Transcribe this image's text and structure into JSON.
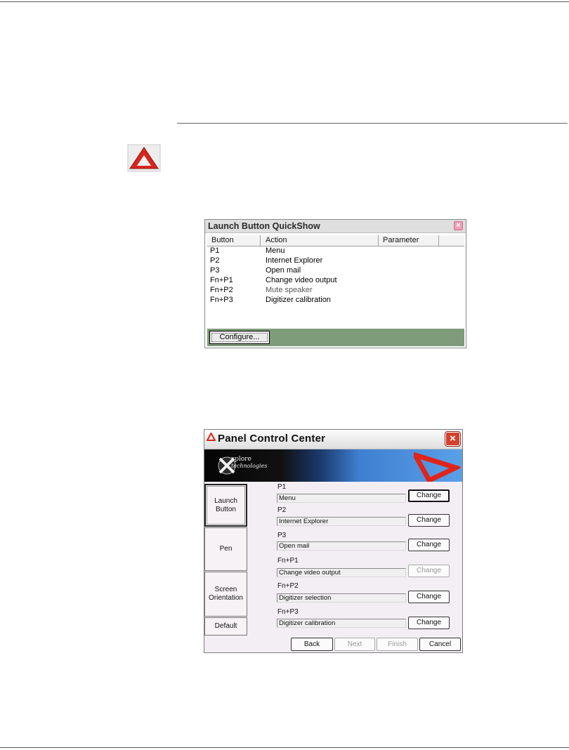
{
  "quickshow": {
    "title": "Launch Button QuickShow",
    "columns": [
      "Button",
      "Action",
      "Parameter"
    ],
    "rows": [
      {
        "button": "P1",
        "action": "Menu"
      },
      {
        "button": "P2",
        "action": "Internet Explorer"
      },
      {
        "button": "P3",
        "action": "Open mail"
      },
      {
        "button": "Fn+P1",
        "action": "Change video output"
      },
      {
        "button": "Fn+P2",
        "action": "Mute speaker"
      },
      {
        "button": "Fn+P3",
        "action": "Digitizer calibration"
      }
    ],
    "configure_label": "Configure..."
  },
  "pcc": {
    "title": "Panel Control Center",
    "close_label": "×",
    "logo": {
      "line1": "xplore",
      "line2": "technologies"
    },
    "sidebar": {
      "launch_button": "Launch Button",
      "pen": "Pen",
      "screen_orientation": "Screen Orientation",
      "default": "Default"
    },
    "fields": [
      {
        "label": "P1",
        "value": "Menu"
      },
      {
        "label": "P2",
        "value": "Internet Explorer"
      },
      {
        "label": "P3",
        "value": "Open mail"
      },
      {
        "label": "Fn+P1",
        "value": "Change video output"
      },
      {
        "label": "Fn+P2",
        "value": "Digitizer selection"
      },
      {
        "label": "Fn+P3",
        "value": "Digitizer calibration"
      }
    ],
    "change_label": "Change",
    "nav": {
      "back": "Back",
      "next": "Next",
      "finish": "Finish",
      "cancel": "Cancel"
    }
  },
  "colors": {
    "warning_red": "#d8261c",
    "quickshow_footer": "#7e9c7a",
    "pcc_background": "#f3eef4"
  }
}
